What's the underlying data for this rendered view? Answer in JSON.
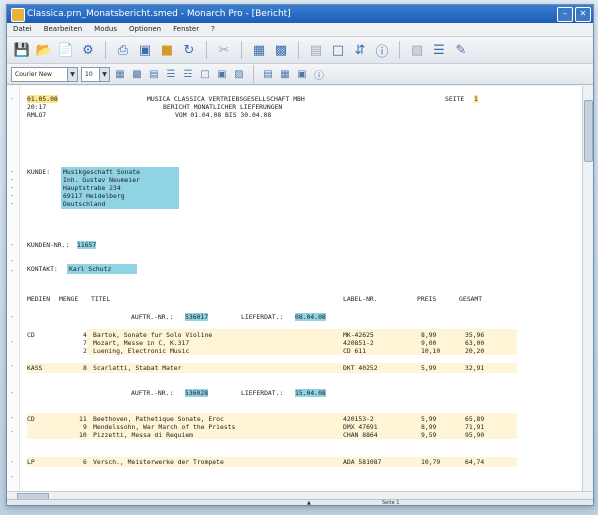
{
  "window": {
    "title": "Classica.prn_Monatsbericht.smed - Monarch Pro - [Bericht]"
  },
  "menu": [
    "Datei",
    "Bearbeiten",
    "Modus",
    "Optionen",
    "Fenster",
    "?"
  ],
  "toolbar2": {
    "font_value": "Courier New",
    "size_value": "10"
  },
  "report": {
    "h1_date": "01.05.08",
    "h1_center": "MUSICA CLASSICA VERTRIEBSGESELLSCHAFT MBH",
    "h1_seite_label": "SEITE",
    "h1_seite_value": "1",
    "h2_left": "20:17",
    "h2_center": "BERICHT MONATLICHER LIEFERUNGEN",
    "h3_left": "RMLO7",
    "h3_center": "VOM 01.04.08 BIS 30.04.08",
    "kunde_label": "KUNDE:",
    "kunde_lines": [
      "Musikgeschaft Sonate",
      "Inh. Gustav Neumeier",
      "Hauptstrabe 234",
      "69117 Heidelberg",
      "Deutschland"
    ],
    "kundennr_label": "KUNDEN-NR.:",
    "kundennr_value": "11657",
    "kontakt_label": "KONTAKT:",
    "kontakt_value": "Karl Schutz",
    "col_medien": "MEDIEN",
    "col_menge": "MENGE",
    "col_titel": "TITEL",
    "col_label": "LABEL-NR.",
    "col_preis": "PREIS",
    "col_gesamt": "GESAMT",
    "auftr_label": "AUFTR.-NR.:",
    "liefdat_label": "LIEFERDAT.:",
    "order1_nr": "536017",
    "order1_date": "08.04.08",
    "order2_nr": "536028",
    "order2_date": "15.04.08",
    "items": [
      {
        "medien": "CD",
        "menge": "4",
        "titel": "Bartok, Sonate fur Solo Violine",
        "label": "MK-42625",
        "preis": "8,99",
        "gesamt": "35,96"
      },
      {
        "medien": "",
        "menge": "7",
        "titel": "Mozart, Messe in C, K.317",
        "label": "420851-2",
        "preis": "9,00",
        "gesamt": "63,00"
      },
      {
        "medien": "",
        "menge": "2",
        "titel": "Luening, Electronic Music",
        "label": "CD 611",
        "preis": "10,10",
        "gesamt": "20,20"
      },
      {
        "medien": "KASS",
        "menge": "8",
        "titel": "Scarlatti, Stabat Mater",
        "label": "DKT 40252",
        "preis": "5,99",
        "gesamt": "32,91"
      },
      {
        "medien": "CD",
        "menge": "11",
        "titel": "Beethoven, Pathetique Sonate, Eroc",
        "label": "420153-2",
        "preis": "5,99",
        "gesamt": "65,89"
      },
      {
        "medien": "",
        "menge": "9",
        "titel": "Mendelssohn, War March of the Priests",
        "label": "DMX 47691",
        "preis": "8,99",
        "gesamt": "71,91"
      },
      {
        "medien": "",
        "menge": "10",
        "titel": "Pizzetti, Messa di Requiem",
        "label": "CHAN 8864",
        "preis": "9,59",
        "gesamt": "95,90"
      },
      {
        "medien": "LP",
        "menge": "6",
        "titel": "Versch., Meisterwerke der Trompete",
        "label": "ADA 581087",
        "preis": "10,79",
        "gesamt": "64,74"
      }
    ]
  },
  "status": {
    "page": "Seite 1"
  }
}
